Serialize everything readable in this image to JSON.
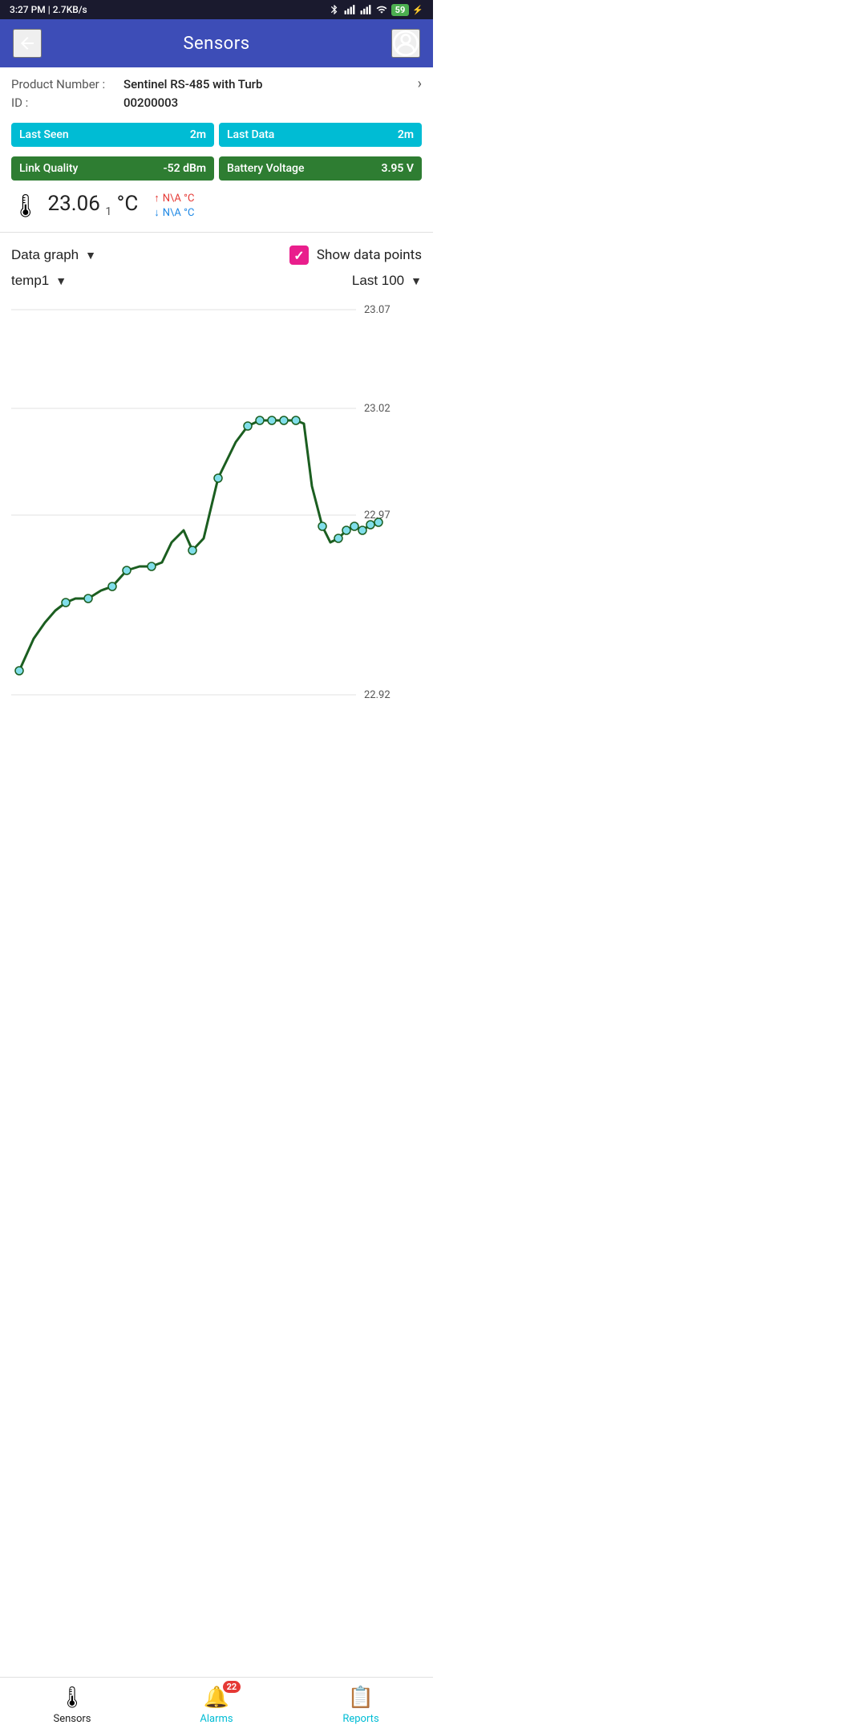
{
  "statusBar": {
    "time": "3:27 PM",
    "network": "2.7KB/s"
  },
  "header": {
    "title": "Sensors",
    "backLabel": "←",
    "profileIcon": "👤"
  },
  "device": {
    "productLabel": "Product Number :",
    "productValue": "Sentinel RS-485 with Turb",
    "idLabel": "ID :",
    "idValue": "00200003"
  },
  "tiles": {
    "lastSeenLabel": "Last Seen",
    "lastSeenValue": "2m",
    "lastDataLabel": "Last Data",
    "lastDataValue": "2m",
    "linkQualityLabel": "Link Quality",
    "linkQualityValue": "-52 dBm",
    "batteryLabel": "Battery Voltage",
    "batteryValue": "3.95 V"
  },
  "temperature": {
    "value": "23.06",
    "unit": "°C",
    "subscript": "1",
    "alertUp": "N\\A °C",
    "alertDown": "N\\A °C"
  },
  "graph": {
    "typeLabel": "Data graph",
    "showDataLabel": "Show data points",
    "channelLabel": "temp1",
    "rangeLabel": "Last 100",
    "yAxisMax": "23.07",
    "yAxisMid1": "23.02",
    "yAxisMid2": "22.97",
    "yAxisMin": "22.92"
  },
  "bottomNav": {
    "sensorsLabel": "Sensors",
    "alarmsLabel": "Alarms",
    "reportsLabel": "Reports",
    "alarmsBadge": "22"
  }
}
